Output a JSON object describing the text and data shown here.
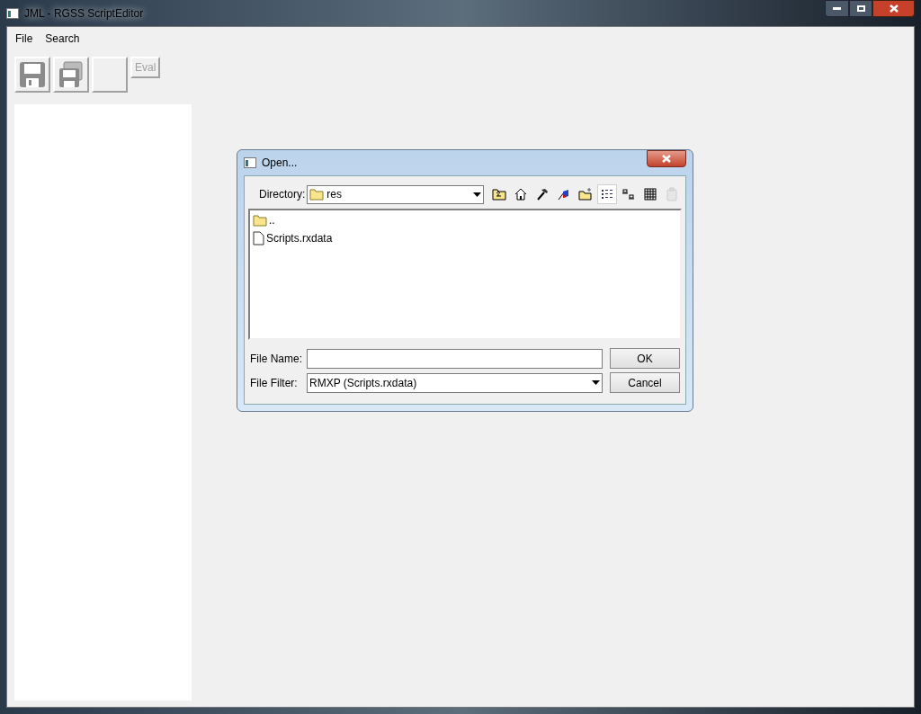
{
  "window": {
    "title": "JML - RGSS ScriptEditor"
  },
  "menu": [
    "File",
    "Search"
  ],
  "toolbar": [
    {
      "kind": "save",
      "disabled": true
    },
    {
      "kind": "save-all",
      "disabled": true
    },
    {
      "kind": "blank"
    },
    {
      "kind": "text",
      "label": "Eval",
      "disabled": true
    }
  ],
  "dialog": {
    "title": "Open...",
    "directory_label": "Directory:",
    "directory": "res",
    "tools": [
      {
        "kind": "up",
        "selected": false,
        "disabled": false
      },
      {
        "kind": "home",
        "selected": false,
        "disabled": false
      },
      {
        "kind": "hammer",
        "selected": false,
        "disabled": false
      },
      {
        "kind": "flag",
        "selected": false,
        "disabled": false
      },
      {
        "kind": "newfolder",
        "selected": false,
        "disabled": false
      },
      {
        "kind": "details",
        "selected": true,
        "disabled": false
      },
      {
        "kind": "list",
        "selected": false,
        "disabled": false
      },
      {
        "kind": "grid",
        "selected": false,
        "disabled": false
      },
      {
        "kind": "clipboard",
        "selected": false,
        "disabled": true
      }
    ],
    "files": [
      {
        "kind": "folder",
        "name": ".."
      },
      {
        "kind": "file",
        "name": "Scripts.rxdata"
      }
    ],
    "file_name_label": "File Name:",
    "file_filter_label": "File Filter:",
    "file_filter": "RMXP (Scripts.rxdata)",
    "buttons": [
      "OK",
      "Cancel"
    ]
  }
}
